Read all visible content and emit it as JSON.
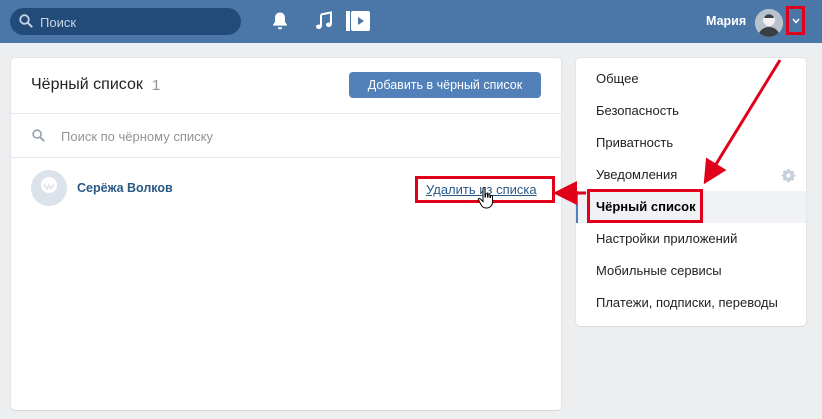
{
  "topbar": {
    "search_placeholder": "Поиск",
    "user_name": "Мария",
    "icons": [
      "search-icon",
      "bell-icon",
      "music-icon",
      "video-icon",
      "chevron-down-icon"
    ]
  },
  "blacklist": {
    "title": "Чёрный список",
    "count": "1",
    "add_button": "Добавить в чёрный список",
    "search_placeholder": "Поиск по чёрному списку",
    "entries": [
      {
        "name": "Серёжа Волков",
        "action": "Удалить из списка"
      }
    ]
  },
  "settings_menu": {
    "items": [
      {
        "label": "Общее"
      },
      {
        "label": "Безопасность"
      },
      {
        "label": "Приватность"
      },
      {
        "label": "Уведомления"
      },
      {
        "label": "Чёрный список"
      },
      {
        "label": "Настройки приложений"
      },
      {
        "label": "Мобильные сервисы"
      },
      {
        "label": "Платежи, подписки, переводы"
      }
    ],
    "active_item": "Чёрный список"
  },
  "colors": {
    "header": "#4a76a8",
    "accent_button": "#5181b8",
    "link": "#2a5885",
    "annotation": "#e0001a"
  }
}
